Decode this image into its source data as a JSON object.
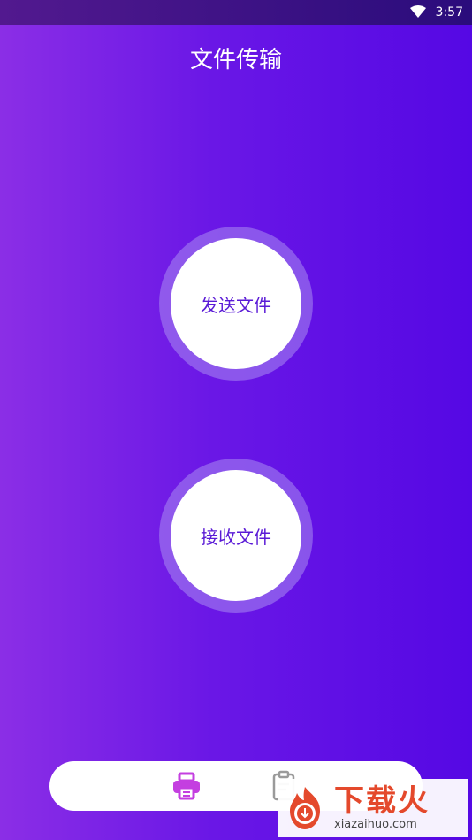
{
  "status_bar": {
    "time": "3:57",
    "wifi_icon": "wifi-icon"
  },
  "header": {
    "title": "文件传输"
  },
  "actions": {
    "send_label": "发送文件",
    "receive_label": "接收文件"
  },
  "bottom_nav": {
    "items": [
      {
        "icon": "printer-icon",
        "active": true
      },
      {
        "icon": "document-icon",
        "active": false
      }
    ]
  },
  "watermark": {
    "text": "下载火",
    "url_text": "xiazaihuo.com"
  },
  "colors": {
    "accent": "#5a1ad6",
    "active_icon": "#c43fe0",
    "inactive_icon": "#9a9a9a",
    "watermark_red": "#e4492c"
  }
}
